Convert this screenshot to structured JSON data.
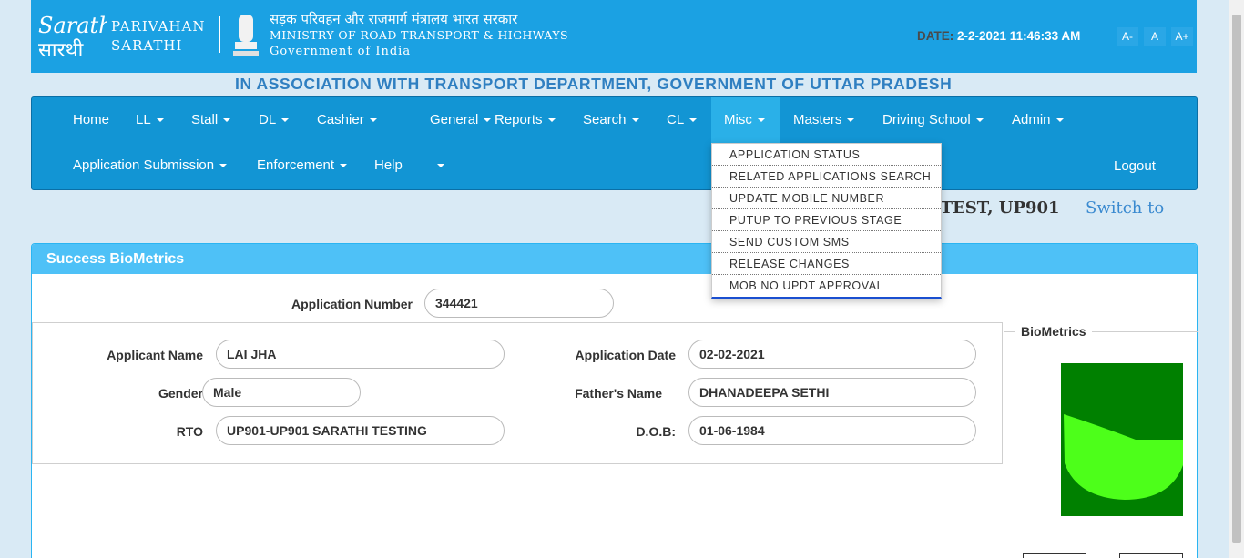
{
  "header": {
    "brand_line1": "PARIVAHAN",
    "brand_line2": "SARATHI",
    "ministry_hindi": "सड़क परिवहन और राजमार्ग मंत्रालय भारत सरकार",
    "ministry_english": "MINISTRY OF ROAD TRANSPORT & HIGHWAYS",
    "government": "Government of India",
    "date_label": "DATE:",
    "date_value": "2-2-2021 11:46:33 AM",
    "font_decrease": "A-",
    "font_normal": "A",
    "font_increase": "A+"
  },
  "association": "IN ASSOCIATION WITH TRANSPORT DEPARTMENT, GOVERNMENT OF UTTAR PRADESH",
  "nav": {
    "row1": [
      "Home",
      "LL",
      "Stall",
      "DL",
      "Cashier",
      "General",
      "Reports",
      "Search",
      "CL",
      "Misc",
      "Masters",
      "Driving School",
      "Admin"
    ],
    "row2": [
      "Application Submission",
      "Enforcement",
      "Help",
      ""
    ],
    "logout": "Logout",
    "active": "Misc"
  },
  "misc_dropdown": [
    "APPLICATION STATUS",
    "RELATED APPLICATIONS SEARCH",
    "UPDATE MOBILE NUMBER",
    "PUTUP TO PREVIOUS STAGE",
    "SEND CUSTOM SMS",
    "RELEASE CHANGES",
    "MOB NO UPDT APPROVAL"
  ],
  "user_text": "I TEST, UP901",
  "switch_to": "Switch to",
  "panel": {
    "title": "Success BioMetrics",
    "application_number_label": "Application Number",
    "application_number": "344421",
    "applicant_name_label": "Applicant Name",
    "applicant_name": "LAI JHA",
    "application_date_label": "Application Date",
    "application_date": "02-02-2021",
    "gender_label": "Gender",
    "gender": "Male",
    "fathers_name_label": "Father's Name",
    "fathers_name": "DHANADEEPA SETHI",
    "rto_label": "RTO",
    "rto": "UP901-UP901 SARATHI TESTING",
    "dob_label": "D.O.B:",
    "dob": "01-06-1984",
    "biometrics_label": "BioMetrics"
  },
  "colors": {
    "header_bg": "#1ba1e3",
    "nav_bg": "#1295d4",
    "panel_head": "#4ec1f7",
    "bio_dark": "#008000",
    "bio_light": "#4dff1a"
  }
}
